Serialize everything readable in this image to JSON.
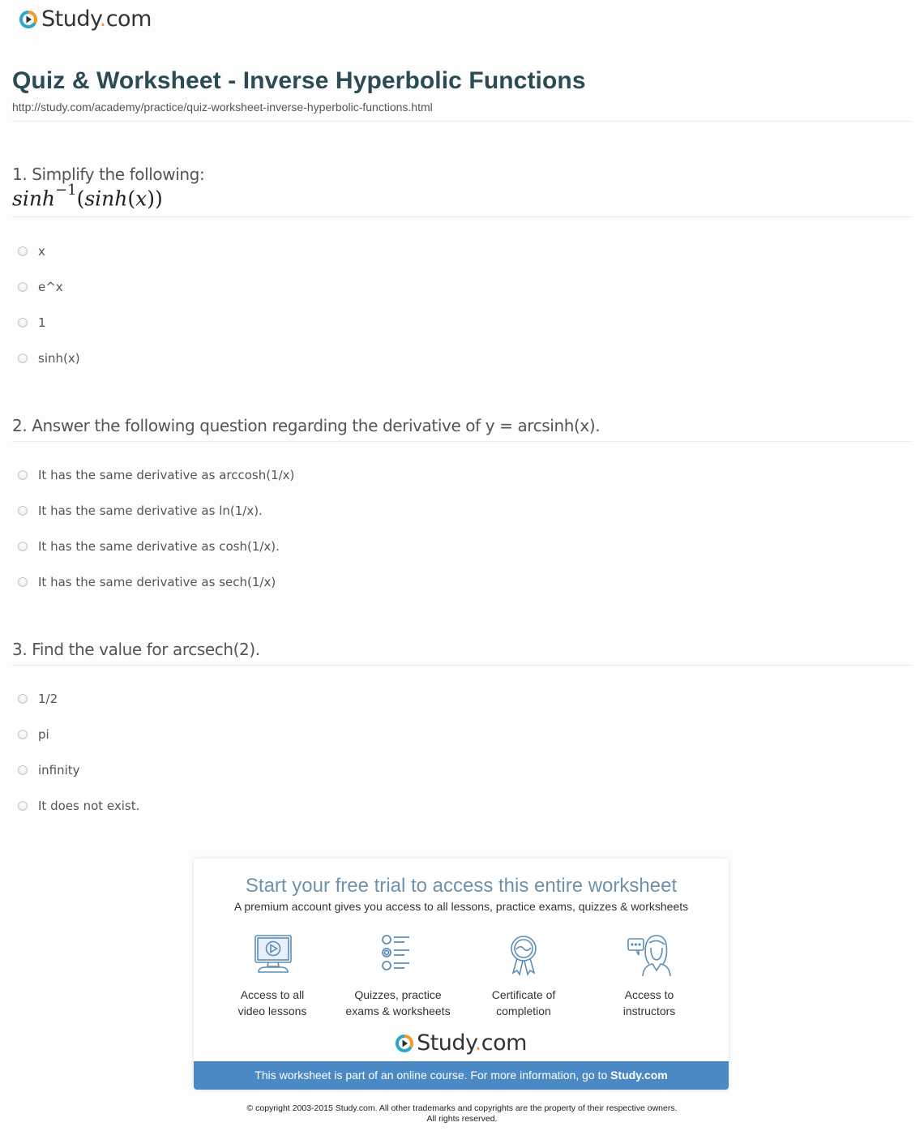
{
  "header": {
    "logo": {
      "word": "Study",
      "dot": ".",
      "tld": "com"
    }
  },
  "page": {
    "title": "Quiz & Worksheet - Inverse Hyperbolic Functions",
    "url": "http://study.com/academy/practice/quiz-worksheet-inverse-hyperbolic-functions.html"
  },
  "questions": [
    {
      "text": "1. Simplify the following:",
      "math": {
        "fn": "sinh",
        "sup": "−1",
        "arg_open": "(",
        "inner": "sinh",
        "inner_open": "(",
        "var": "x",
        "close": "))"
      },
      "options": [
        "x",
        "e^x",
        "1",
        "sinh(x)"
      ]
    },
    {
      "text": "2. Answer the following question regarding the derivative of y = arcsinh(x).",
      "options": [
        "It has the same derivative as arccosh(1/x)",
        "It has the same derivative as ln(1/x).",
        "It has the same derivative as cosh(1/x).",
        "It has the same derivative as sech(1/x)"
      ]
    },
    {
      "text": "3. Find the value for arcsech(2).",
      "options": [
        "1/2",
        "pi",
        "infinity",
        "It does not exist."
      ]
    }
  ],
  "promo": {
    "title": "Start your free trial to access this entire worksheet",
    "subtitle": "A premium account gives you access to all lessons, practice exams, quizzes & worksheets",
    "features": [
      {
        "icon": "monitor-play-icon",
        "line1": "Access to all",
        "line2": "video lessons"
      },
      {
        "icon": "checklist-icon",
        "line1": "Quizzes, practice",
        "line2": "exams & worksheets"
      },
      {
        "icon": "certificate-ribbon-icon",
        "line1": "Certificate of",
        "line2": "completion"
      },
      {
        "icon": "instructor-chat-icon",
        "line1": "Access to",
        "line2": "instructors"
      }
    ],
    "logo": {
      "word": "Study",
      "dot": ".",
      "tld": "com"
    },
    "banner_text": "This worksheet is part of an online course. For more information, go to ",
    "banner_link": "Study.com"
  },
  "footer": {
    "line1": "© copyright 2003-2015 Study.com. All other trademarks and copyrights are the property of their respective owners.",
    "line2": "All rights reserved."
  },
  "colors": {
    "brand_teal": "#2aa7c9",
    "brand_orange": "#f29a2e",
    "title": "#2b4b55",
    "promo_title": "#6e91ad",
    "banner": "#4a89c4",
    "icon_stroke": "#5b8db8"
  }
}
